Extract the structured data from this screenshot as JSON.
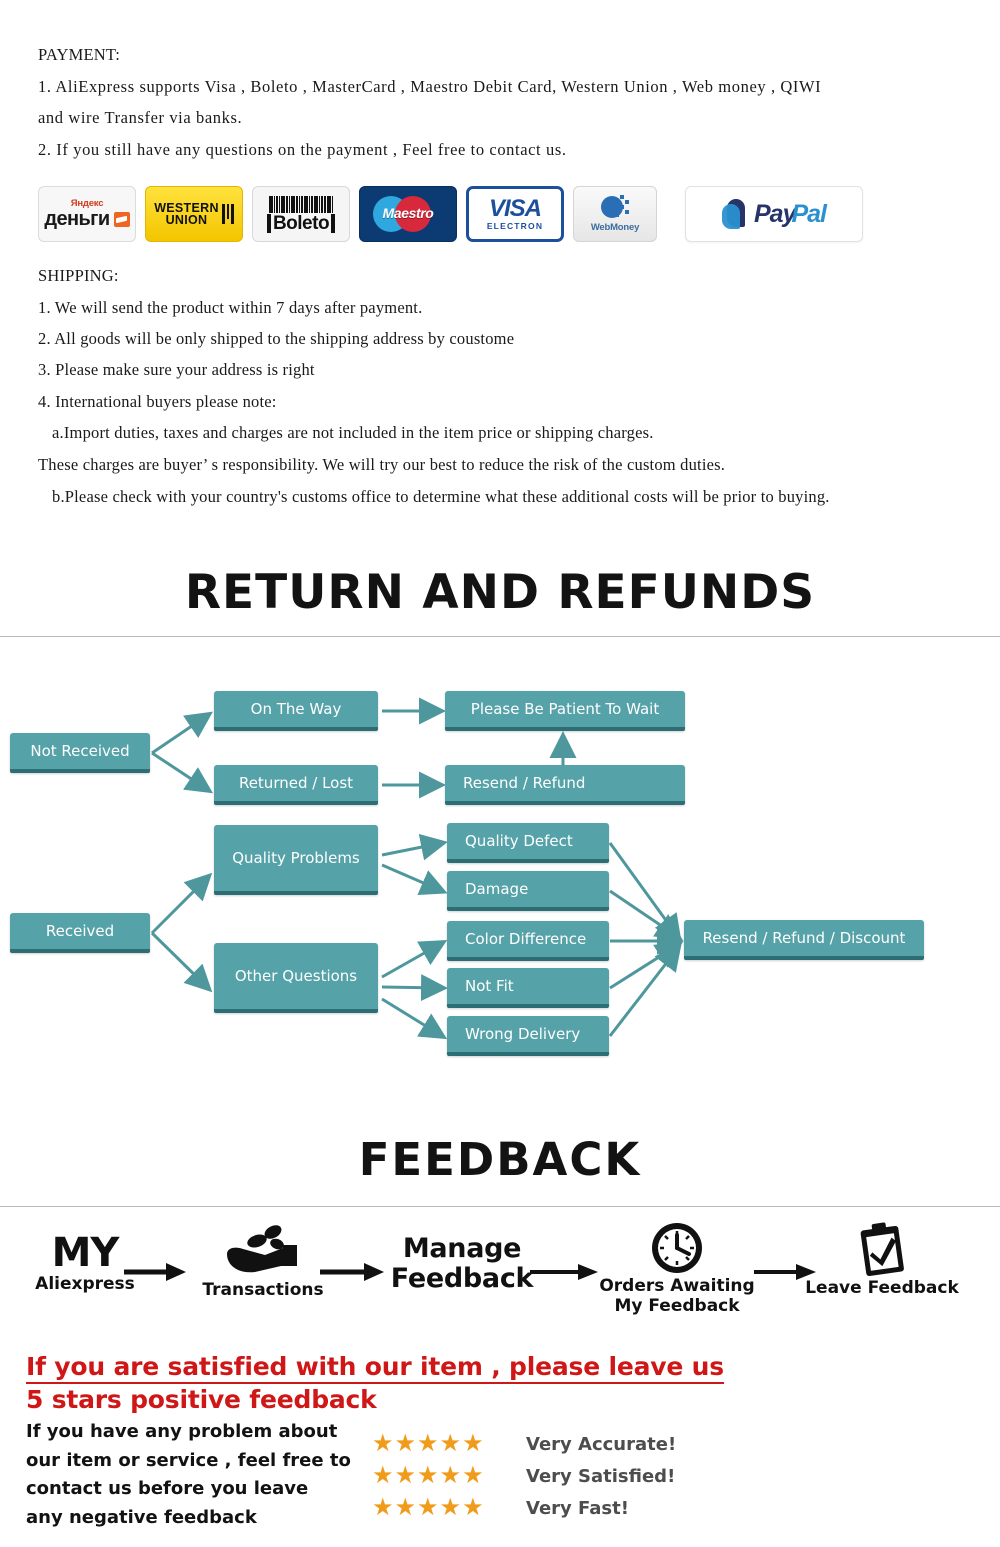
{
  "payment": {
    "title": "PAYMENT:",
    "lines": [
      "1. AliExpress  supports Visa , Boleto , MasterCard , Maestro  Debit  Card, Western  Union , Web   money , QIWI",
      "and  wire  Transfer  via  banks.",
      "2.  If  you  still  have  any  questions  on  the  payment , Feel  free  to  contact  us."
    ],
    "logos": [
      {
        "name": "yandex-money-logo",
        "top": "Яндекс",
        "label": "деньги"
      },
      {
        "name": "western-union-logo",
        "line1": "WESTERN",
        "line2": "UNION"
      },
      {
        "name": "boleto-logo",
        "label": "Boleto"
      },
      {
        "name": "maestro-logo",
        "label": "Maestro"
      },
      {
        "name": "visa-electron-logo",
        "label": "VISA",
        "sub": "ELECTRON"
      },
      {
        "name": "webmoney-logo",
        "label": "WebMoney"
      },
      {
        "name": "paypal-logo",
        "part1": "Pay",
        "part2": "Pal"
      }
    ]
  },
  "shipping": {
    "title": "SHIPPING:",
    "lines": [
      "1. We will send the product within 7 days after payment.",
      "2. All goods will be only shipped to the shipping address by coustome",
      "3. Please make sure your address is right",
      "4. International buyers please note:",
      "a.Import duties, taxes and charges are not included in the item price or shipping charges.",
      "These charges are buyer’ s responsibility. We will try our best to reduce the risk of the custom duties.",
      "b.Please check with your country's customs office to determine what these additional costs will be prior  to buying."
    ]
  },
  "sections": {
    "return_title": "RETURN AND REFUNDS",
    "feedback_title": "FEEDBACK"
  },
  "flowchart": {
    "accent_color": "#55a2a8",
    "accent_shadow": "#2c6e74",
    "nodes": {
      "not_received": "Not Received",
      "on_the_way": "On The Way",
      "returned_lost": "Returned / Lost",
      "please_wait": "Please Be Patient To Wait",
      "resend_refund": "Resend / Refund",
      "received": "Received",
      "quality_problems": "Quality Problems",
      "other_questions": "Other Questions",
      "quality_defect": "Quality Defect",
      "damage": "Damage",
      "color_difference": "Color Difference",
      "not_fit": "Not Fit",
      "wrong_delivery": "Wrong Delivery",
      "resend_refund_discount": "Resend / Refund / Discount"
    }
  },
  "feedback_flow": {
    "steps": [
      {
        "name": "my-aliexpress",
        "big": "MY",
        "label": "Aliexpress"
      },
      {
        "name": "transactions",
        "icon": "hand-coins-icon",
        "label": "Transactions"
      },
      {
        "name": "manage-feedback",
        "mid1": "Manage",
        "mid2": "Feedback"
      },
      {
        "name": "orders-awaiting-my-feedback",
        "icon": "clock-icon",
        "label1": "Orders Awaiting",
        "label2": "My Feedback"
      },
      {
        "name": "leave-feedback",
        "icon": "clipboard-check-icon",
        "label": "Leave Feedback"
      }
    ]
  },
  "promo": {
    "color": "#d01717",
    "line1": "If you are satisfied with our item , please leave us",
    "line2": "5 stars positive feedback"
  },
  "bottom": {
    "text_lines": [
      "If you have any problem about",
      "our item or service , feel free to",
      "contact us before you  leave",
      "any negative feedback"
    ],
    "star_color": "#f09b1a",
    "ratings": [
      {
        "stars": 5,
        "label": "Very Accurate!"
      },
      {
        "stars": 5,
        "label": "Very Satisfied!"
      },
      {
        "stars": 5,
        "label": "Very Fast!"
      }
    ]
  }
}
